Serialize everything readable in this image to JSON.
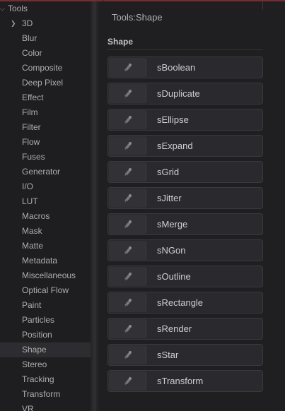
{
  "tree": {
    "root_label": "Tools",
    "items": [
      {
        "label": "3D",
        "expandable": true
      },
      {
        "label": "Blur"
      },
      {
        "label": "Color"
      },
      {
        "label": "Composite"
      },
      {
        "label": "Deep Pixel"
      },
      {
        "label": "Effect"
      },
      {
        "label": "Film"
      },
      {
        "label": "Filter"
      },
      {
        "label": "Flow"
      },
      {
        "label": "Fuses"
      },
      {
        "label": "Generator"
      },
      {
        "label": "I/O"
      },
      {
        "label": "LUT"
      },
      {
        "label": "Macros"
      },
      {
        "label": "Mask"
      },
      {
        "label": "Matte"
      },
      {
        "label": "Metadata"
      },
      {
        "label": "Miscellaneous"
      },
      {
        "label": "Optical Flow"
      },
      {
        "label": "Paint"
      },
      {
        "label": "Particles"
      },
      {
        "label": "Position"
      },
      {
        "label": "Shape",
        "selected": true
      },
      {
        "label": "Stereo"
      },
      {
        "label": "Tracking"
      },
      {
        "label": "Transform"
      },
      {
        "label": "VR"
      }
    ]
  },
  "panel": {
    "title": "Tools:Shape",
    "section_header": "Shape",
    "tools": [
      {
        "label": "sBoolean",
        "icon": "shape-tool-icon"
      },
      {
        "label": "sDuplicate",
        "icon": "shape-tool-icon"
      },
      {
        "label": "sEllipse",
        "icon": "shape-tool-icon"
      },
      {
        "label": "sExpand",
        "icon": "shape-tool-icon"
      },
      {
        "label": "sGrid",
        "icon": "shape-tool-icon"
      },
      {
        "label": "sJitter",
        "icon": "shape-tool-icon"
      },
      {
        "label": "sMerge",
        "icon": "shape-tool-icon"
      },
      {
        "label": "sNGon",
        "icon": "shape-tool-icon"
      },
      {
        "label": "sOutline",
        "icon": "shape-tool-icon"
      },
      {
        "label": "sRectangle",
        "icon": "shape-tool-icon"
      },
      {
        "label": "sRender",
        "icon": "shape-tool-icon"
      },
      {
        "label": "sStar",
        "icon": "shape-tool-icon"
      },
      {
        "label": "sTransform",
        "icon": "shape-tool-icon"
      }
    ]
  },
  "colors": {
    "background": "#1e1e20",
    "selected_row": "#2d2d31",
    "button_bg": "#2a2a2e",
    "top_accent": "#7a2a30"
  }
}
